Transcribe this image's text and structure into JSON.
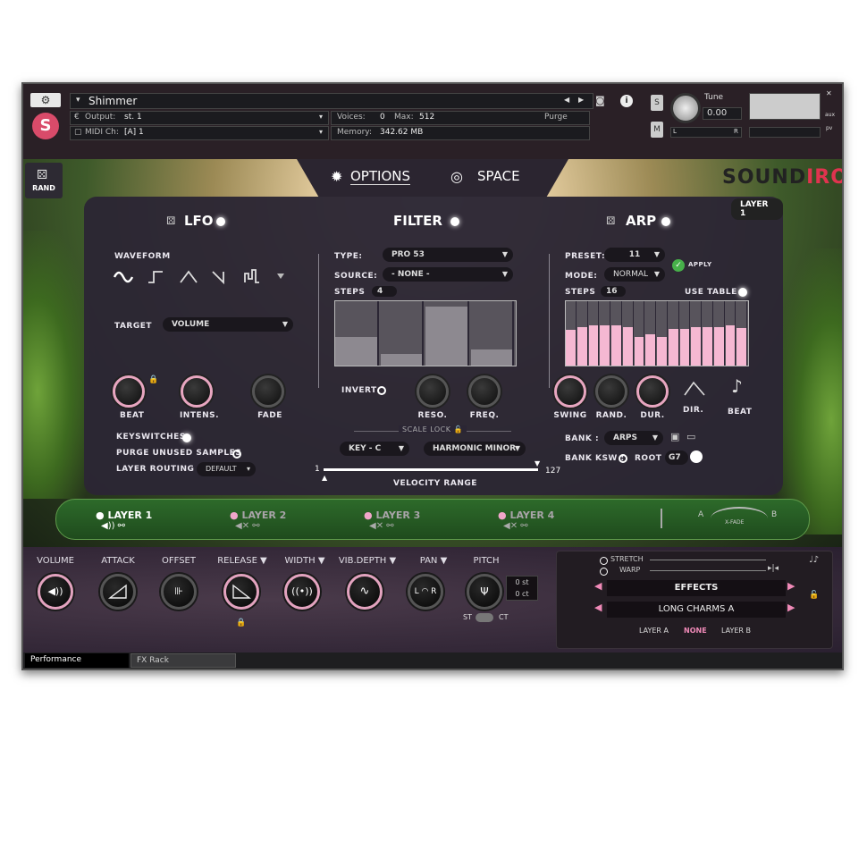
{
  "header": {
    "instrument_name": "Shimmer",
    "output_label": "Output:",
    "output_value": "st. 1",
    "midi_label": "MIDI Ch:",
    "midi_value": "[A]  1",
    "voices_label": "Voices:",
    "voices_value": "0",
    "max_label": "Max:",
    "max_value": "512",
    "memory_label": "Memory:",
    "memory_value": "342.62 MB",
    "purge_label": "Purge",
    "tune_label": "Tune",
    "tune_value": "0.00",
    "s_button": "S",
    "m_button": "M",
    "aux_label": "aux",
    "pv_label": "pv",
    "l_label": "L",
    "r_label": "R"
  },
  "tabs": {
    "options": "OPTIONS",
    "space": "SPACE"
  },
  "brand": {
    "sound": "SOUND",
    "iron": "IRON"
  },
  "rand": {
    "label": "RAND"
  },
  "layer_badge": "LAYER 1",
  "lfo": {
    "title": "LFO",
    "waveform_label": "WAVEFORM",
    "target_label": "TARGET",
    "target_value": "VOLUME",
    "knobs": [
      "BEAT",
      "INTENS.",
      "FADE"
    ],
    "keyswitches": "KEYSWITCHES",
    "purge_unused": "PURGE UNUSED SAMPLES",
    "layer_routing": "LAYER ROUTING",
    "routing_value": "DEFAULT"
  },
  "filter": {
    "title": "FILTER",
    "type_label": "TYPE:",
    "type_value": "PRO 53",
    "source_label": "SOURCE:",
    "source_value": "- NONE -",
    "steps_label": "STEPS",
    "steps_value": "4",
    "step_values": [
      0.45,
      0.18,
      0.92,
      0.25
    ],
    "invert": "INVERT",
    "knobs": [
      "RESO.",
      "FREQ."
    ],
    "scale_lock": "SCALE LOCK",
    "key_value": "KEY - C",
    "scale_value": "HARMONIC MINOR",
    "vel_min": "1",
    "vel_max": "127",
    "velocity_range": "VELOCITY RANGE"
  },
  "arp": {
    "title": "ARP",
    "preset_label": "PRESET:",
    "preset_value": "11",
    "mode_label": "MODE:",
    "mode_value": "NORMAL",
    "apply": "APPLY",
    "steps_label": "STEPS",
    "steps_value": "16",
    "use_table": "USE TABLE",
    "step_values": [
      0.55,
      0.6,
      0.63,
      0.63,
      0.62,
      0.6,
      0.45,
      0.48,
      0.44,
      0.57,
      0.57,
      0.6,
      0.6,
      0.6,
      0.62,
      0.58
    ],
    "knobs": [
      "SWING",
      "RAND.",
      "DUR."
    ],
    "dir": "DIR.",
    "beat": "BEAT",
    "bank_label": "BANK :",
    "bank_value": "ARPS",
    "bank_ksw": "BANK KSW :",
    "root_label": "ROOT :",
    "root_value": "G7"
  },
  "layers": [
    {
      "name": "LAYER 1"
    },
    {
      "name": "LAYER 2"
    },
    {
      "name": "LAYER 3"
    },
    {
      "name": "LAYER 4"
    }
  ],
  "xfade": {
    "a": "A",
    "b": "B",
    "label": "X-FADE"
  },
  "controls": [
    {
      "label": "VOLUME"
    },
    {
      "label": "ATTACK"
    },
    {
      "label": "OFFSET"
    },
    {
      "label": "RELEASE ▼"
    },
    {
      "label": "WIDTH ▼"
    },
    {
      "label": "VIB.DEPTH ▼"
    },
    {
      "label": "PAN ▼"
    },
    {
      "label": "PITCH"
    }
  ],
  "pitch": {
    "st": "0 st",
    "ct": "0 ct",
    "st_label": "ST",
    "ct_label": "CT"
  },
  "fx": {
    "stretch": "STRETCH",
    "warp": "WARP",
    "effects": "EFFECTS",
    "preset": "LONG CHARMS A",
    "layer_a": "LAYER A",
    "none": "NONE",
    "layer_b": "LAYER B"
  },
  "bottom_tabs": {
    "performance": "Performance",
    "fx_rack": "FX Rack"
  }
}
